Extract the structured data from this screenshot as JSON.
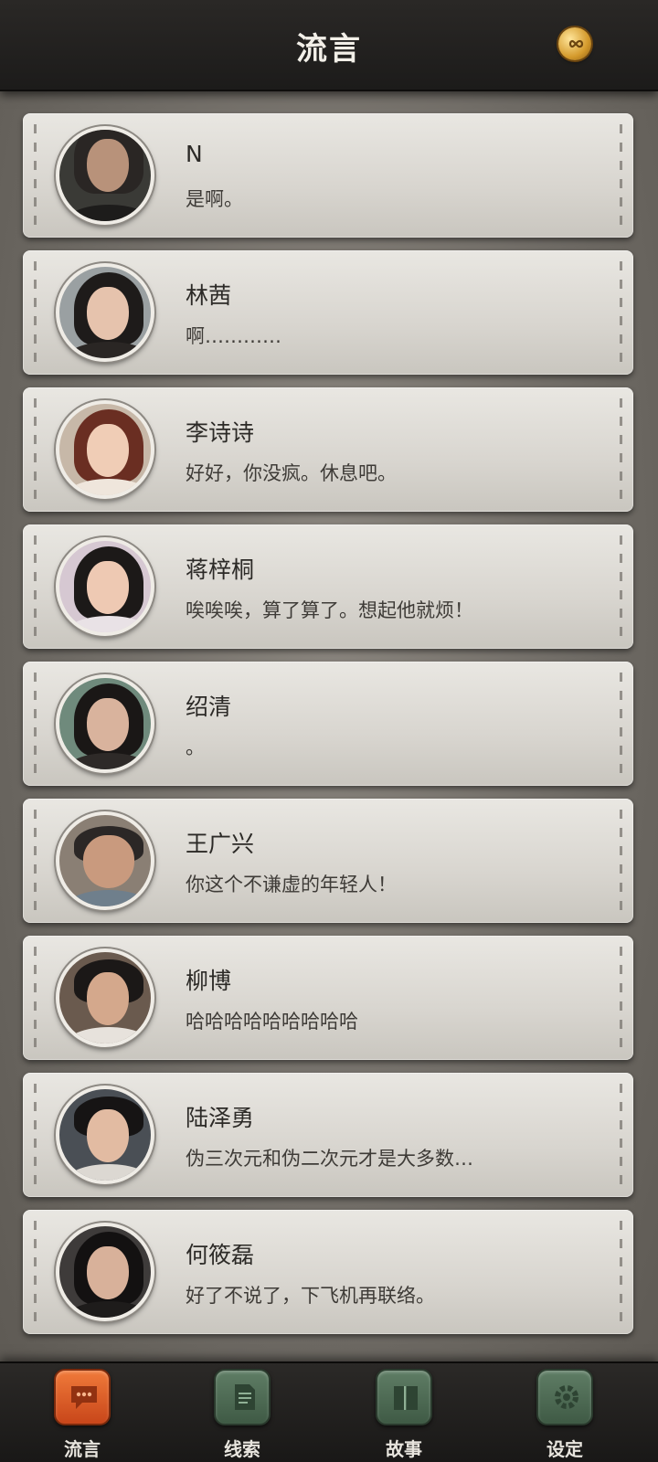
{
  "header": {
    "title": "流言",
    "coin_icon": "infinity-coin-icon"
  },
  "contacts": [
    {
      "name": "N",
      "message": "是啊。"
    },
    {
      "name": "林茜",
      "message": "啊…………"
    },
    {
      "name": "李诗诗",
      "message": "好好，你没疯。休息吧。"
    },
    {
      "name": "蒋梓桐",
      "message": "唉唉唉，算了算了。想起他就烦！"
    },
    {
      "name": "绍清",
      "message": "。"
    },
    {
      "name": "王广兴",
      "message": "你这个不谦虚的年轻人！"
    },
    {
      "name": "柳博",
      "message": "哈哈哈哈哈哈哈哈哈"
    },
    {
      "name": "陆泽勇",
      "message": "伪三次元和伪二次元才是大多数…"
    },
    {
      "name": "何筱磊",
      "message": "好了不说了，下飞机再联络。"
    }
  ],
  "nav": [
    {
      "label": "流言",
      "icon": "chat-bubble-icon",
      "active": true
    },
    {
      "label": "线索",
      "icon": "document-icon",
      "active": false
    },
    {
      "label": "故事",
      "icon": "book-icon",
      "active": false
    },
    {
      "label": "设定",
      "icon": "gear-icon",
      "active": false
    }
  ],
  "colors": {
    "active_tab": "#e0602a",
    "inactive_tab": "#4f6e56"
  }
}
